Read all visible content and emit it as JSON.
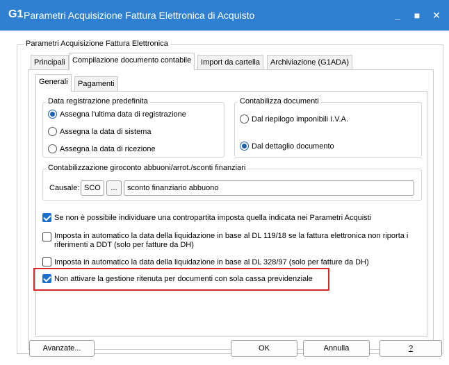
{
  "window": {
    "logo": "G1",
    "title": "Parametri Acquisizione Fattura Elettronica di Acquisto",
    "controls": {
      "minimize": "_",
      "maximize": "■",
      "close": "✕"
    }
  },
  "frame": {
    "label": "Parametri Acquisizione Fattura Elettronica"
  },
  "tabs": [
    {
      "label": "Principali"
    },
    {
      "label": "Compilazione documento contabile",
      "active": true
    },
    {
      "label": "Import da cartella"
    },
    {
      "label": "Archiviazione (G1ADA)"
    }
  ],
  "subtabs": [
    {
      "label": "Generali",
      "active": true
    },
    {
      "label": "Pagamenti"
    }
  ],
  "data_registrazione": {
    "label": "Data registrazione predefinita",
    "options": [
      {
        "label": "Assegna l'ultima data di registrazione",
        "selected": true
      },
      {
        "label": "Assegna la data di sistema",
        "selected": false
      },
      {
        "label": "Assegna la data di ricezione",
        "selected": false
      }
    ]
  },
  "contabilizza": {
    "label": "Contabilizza documenti",
    "options": [
      {
        "label": "Dal riepilogo imponibili I.V.A.",
        "selected": false
      },
      {
        "label": "Dal dettaglio documento",
        "selected": true
      }
    ]
  },
  "giroconto": {
    "label": "Contabilizzazione giroconto abbuoni/arrot./sconti finanziari",
    "causale_label": "Causale:",
    "causale_code": "SCO",
    "browse_label": "...",
    "causale_desc": "sconto finanziario abbuono"
  },
  "checks": [
    {
      "label": "Se non è possibile individuare una contropartita imposta quella indicata nei Parametri Acquisti",
      "checked": true
    },
    {
      "label_line1": "Imposta in automatico la data della liquidazione in base al DL 119/18 se la fattura elettronica non riporta i",
      "label_line2": "riferimenti a DDT (solo per fatture da DH)",
      "checked": false
    },
    {
      "label": "Imposta in automatico la data della liquidazione in base al DL 328/97 (solo per fatture da DH)",
      "checked": false
    },
    {
      "label": "Non attivare la gestione ritenuta per documenti con sola cassa previdenziale",
      "checked": true
    }
  ],
  "buttons": {
    "advanced": "Avanzate...",
    "ok": "OK",
    "cancel": "Annulla",
    "help": "?"
  },
  "colors": {
    "titlebar": "#2f80d1",
    "accent": "#1a6fce",
    "highlight": "#d9252b"
  }
}
